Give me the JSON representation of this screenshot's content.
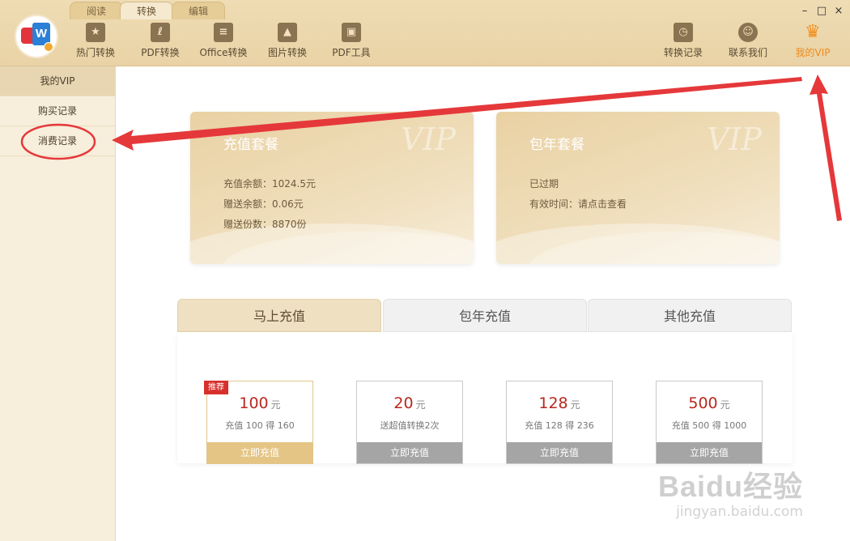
{
  "top_tabs": [
    "阅读",
    "转换",
    "编辑"
  ],
  "active_top_tab": "转换",
  "toolbar": {
    "left": [
      {
        "label": "热门转换",
        "icon": "star-doc-icon"
      },
      {
        "label": "PDF转换",
        "icon": "pdf-icon"
      },
      {
        "label": "Office转换",
        "icon": "office-doc-icon"
      },
      {
        "label": "图片转换",
        "icon": "image-icon"
      },
      {
        "label": "PDF工具",
        "icon": "toolbox-icon"
      }
    ],
    "right": [
      {
        "label": "转换记录",
        "icon": "history-clock-icon"
      },
      {
        "label": "联系我们",
        "icon": "headset-icon"
      },
      {
        "label": "我的VIP",
        "icon": "crown-icon"
      }
    ]
  },
  "window_controls": [
    "–",
    "□",
    "×"
  ],
  "sidebar": {
    "items": [
      "我的VIP",
      "购买记录",
      "消费记录"
    ]
  },
  "cards": {
    "recharge": {
      "title": "充值套餐",
      "watermark": "VIP",
      "lines": [
        "充值余额：1024.5元",
        "赠送余额：0.06元",
        "赠送份数：8870份"
      ]
    },
    "annual": {
      "title": "包年套餐",
      "watermark": "VIP",
      "lines": [
        "已过期",
        "有效时间：请点击查看"
      ]
    }
  },
  "tabs": [
    "马上充值",
    "包年充值",
    "其他充值"
  ],
  "badge": "推荐",
  "packages": [
    {
      "price": "100",
      "unit": "元",
      "desc": "充值 100 得 160",
      "button": "立即充值"
    },
    {
      "price": "20",
      "unit": "元",
      "desc": "送超值转换2次",
      "button": "立即充值"
    },
    {
      "price": "128",
      "unit": "元",
      "desc": "充值 128 得 236",
      "button": "立即充值"
    },
    {
      "price": "500",
      "unit": "元",
      "desc": "充值 500 得 1000",
      "button": "立即充值"
    }
  ],
  "watermark": {
    "text": "Baidu经验",
    "url": "jingyan.baidu.com"
  },
  "colors": {
    "accent_red": "#e5383a",
    "vip_orange": "#f08a1c",
    "price_red": "#b8281f"
  }
}
